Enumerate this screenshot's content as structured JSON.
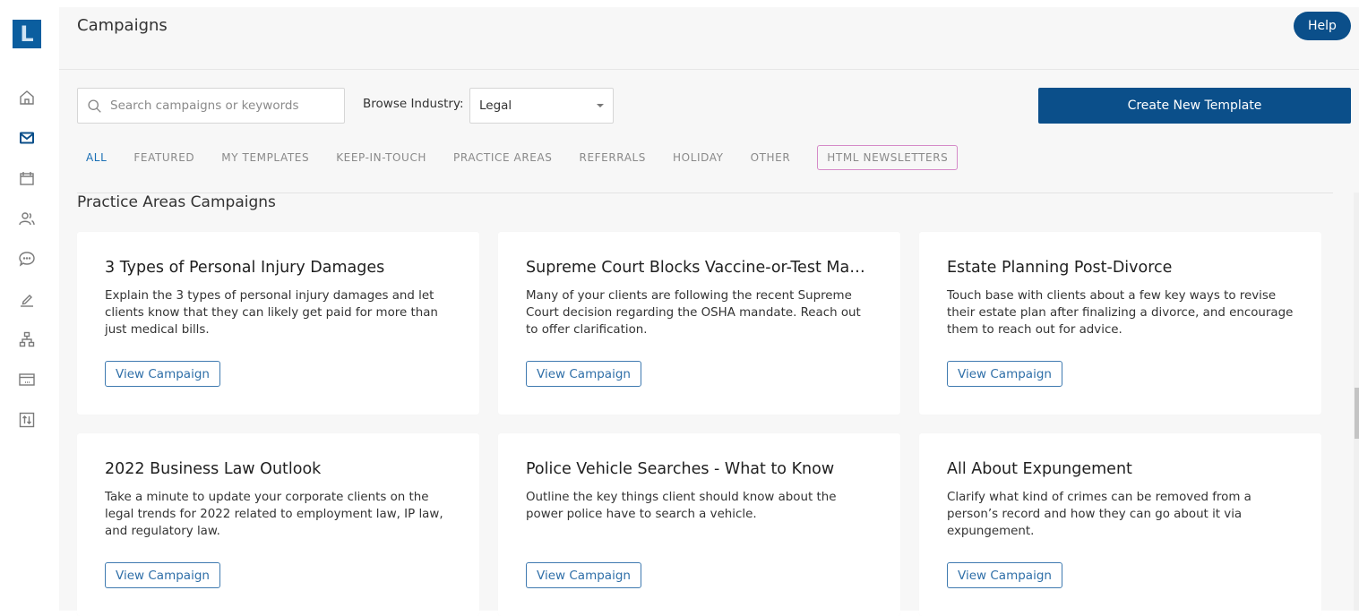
{
  "sidebar": {
    "logo_letter": "L",
    "items": [
      {
        "name": "home",
        "icon": "home-icon",
        "active": false
      },
      {
        "name": "campaigns",
        "icon": "mail-icon",
        "active": true
      },
      {
        "name": "calendar",
        "icon": "calendar-icon",
        "active": false
      },
      {
        "name": "contacts",
        "icon": "users-icon",
        "active": false
      },
      {
        "name": "messages",
        "icon": "chat-icon",
        "active": false
      },
      {
        "name": "edit",
        "icon": "pencil-icon",
        "active": false
      },
      {
        "name": "referral-network",
        "icon": "sitemap-icon",
        "active": false
      },
      {
        "name": "billing",
        "icon": "credit-card-icon",
        "active": false
      },
      {
        "name": "import-export",
        "icon": "transfer-icon",
        "active": false
      }
    ]
  },
  "header": {
    "title": "Campaigns",
    "help_label": "Help"
  },
  "toolbar": {
    "search_placeholder": "Search campaigns or keywords",
    "search_value": "",
    "browse_label": "Browse Industry:",
    "industry_selected": "Legal",
    "create_label": "Create New Template"
  },
  "tabs": [
    {
      "label": "ALL",
      "active": true
    },
    {
      "label": "FEATURED",
      "active": false
    },
    {
      "label": "MY TEMPLATES",
      "active": false
    },
    {
      "label": "KEEP-IN-TOUCH",
      "active": false
    },
    {
      "label": "PRACTICE AREAS",
      "active": false
    },
    {
      "label": "REFERRALS",
      "active": false
    },
    {
      "label": "HOLIDAY",
      "active": false
    },
    {
      "label": "OTHER",
      "active": false
    },
    {
      "label": "HTML NEWSLETTERS",
      "active": false
    }
  ],
  "section": {
    "title": "Practice Areas Campaigns"
  },
  "cards": [
    {
      "title": "3 Types of Personal Injury Damages",
      "description": "Explain the 3 types of personal injury damages and let clients know that they can likely get paid for more than just medical bills.",
      "button": "View Campaign"
    },
    {
      "title": "Supreme Court Blocks Vaccine-or-Test Man...",
      "description": "Many of your clients are following the recent Supreme Court decision regarding the OSHA mandate. Reach out to offer clarification.",
      "button": "View Campaign"
    },
    {
      "title": "Estate Planning Post-Divorce",
      "description": "Touch base with clients about a few key ways to revise their estate plan after finalizing a divorce, and encourage them to reach out for advice.",
      "button": "View Campaign"
    },
    {
      "title": "2022 Business Law Outlook",
      "description": "Take a minute to update your corporate clients on the legal trends for 2022 related to employment law, IP law, and regulatory law.",
      "button": "View Campaign"
    },
    {
      "title": "Police Vehicle Searches - What to Know",
      "description": "Outline the key things client should know about the power police have to search a vehicle.",
      "button": "View Campaign"
    },
    {
      "title": "All About Expungement",
      "description": "Clarify what kind of crimes can be removed from a person’s record and how they can go about it via expungement.",
      "button": "View Campaign"
    }
  ],
  "colors": {
    "brand": "#0b4f8a",
    "logo_bg": "#0b5e9f",
    "active_tab": "#1a6fb5",
    "newsletter_tab_border": "#d58ac8",
    "page_bg": "#f7f7f7"
  }
}
